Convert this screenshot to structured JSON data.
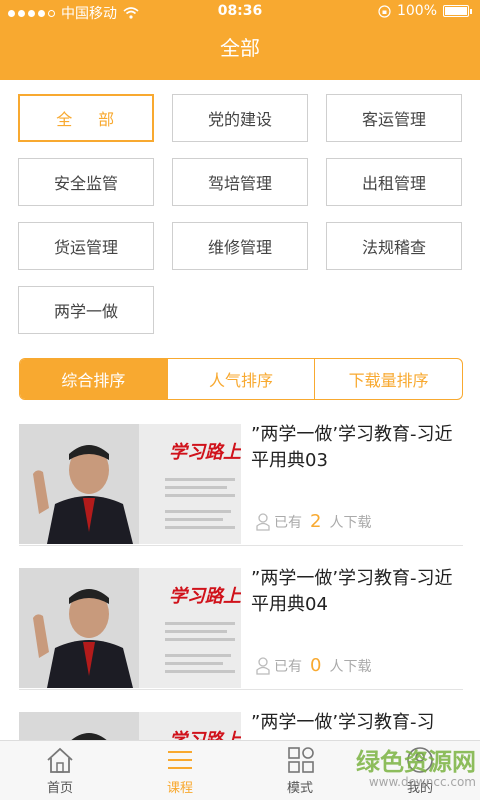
{
  "status_bar": {
    "carrier": "中国移动",
    "time": "08:36",
    "battery": "100%"
  },
  "header": {
    "title": "全部"
  },
  "categories": [
    {
      "label": "全　 部",
      "active": true
    },
    {
      "label": "党的建设"
    },
    {
      "label": "客运管理"
    },
    {
      "label": "安全监管"
    },
    {
      "label": "驾培管理"
    },
    {
      "label": "出租管理"
    },
    {
      "label": "货运管理"
    },
    {
      "label": "维修管理"
    },
    {
      "label": "法规稽查"
    },
    {
      "label": "两学一做"
    }
  ],
  "sort_tabs": [
    {
      "label": "综合排序",
      "active": true
    },
    {
      "label": "人气排序"
    },
    {
      "label": "下载量排序"
    }
  ],
  "items": [
    {
      "title": "”两学一做’学习教育-习近平用典03",
      "downloads_prefix": "已有",
      "downloads_count": "2",
      "downloads_suffix": "人下载",
      "thumb_text": "学习路上"
    },
    {
      "title": "”两学一做’学习教育-习近平用典04",
      "downloads_prefix": "已有",
      "downloads_count": "0",
      "downloads_suffix": "人下载",
      "thumb_text": "学习路上"
    },
    {
      "title": "”两学一做’学习教育-习",
      "thumb_text": "学习路上"
    }
  ],
  "tabbar": [
    {
      "label": "首页",
      "icon": "home-icon"
    },
    {
      "label": "课程",
      "icon": "menu-icon",
      "active": true
    },
    {
      "label": "模式",
      "icon": "grid-icon"
    },
    {
      "label": "我的",
      "icon": "user-icon"
    }
  ],
  "watermark": {
    "main": "绿色资源网",
    "sub": "www.downcc.com"
  },
  "colors": {
    "accent": "#f8a930",
    "text": "#333333",
    "border": "#cfcfcf"
  }
}
